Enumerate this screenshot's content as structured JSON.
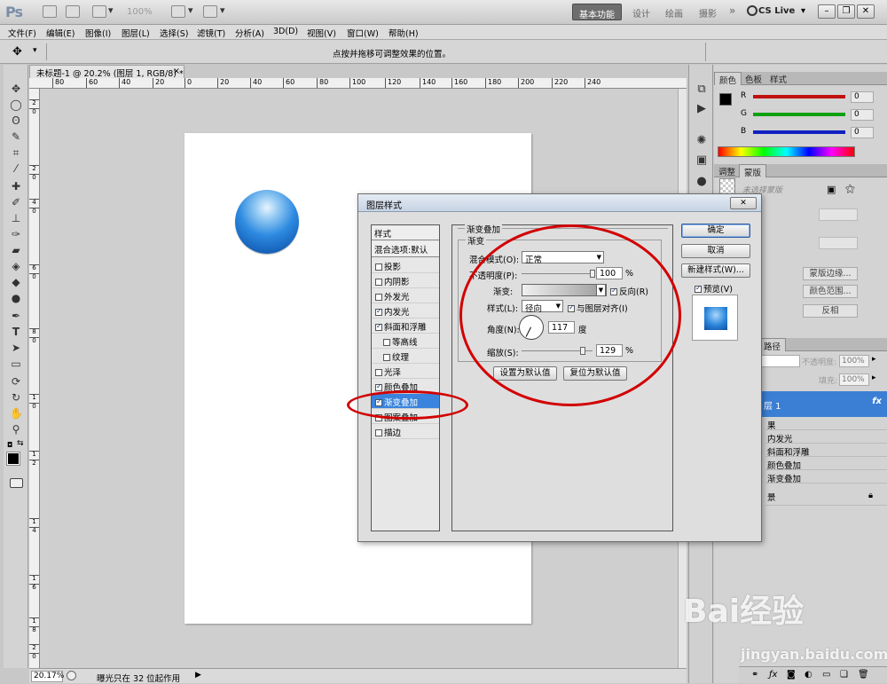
{
  "app": {
    "logo": "Ps"
  },
  "titlebar": {
    "zoom": "100%",
    "workspaces": [
      "基本功能",
      "设计",
      "绘画",
      "摄影"
    ],
    "more": "»",
    "cs_live": "CS Live",
    "cs_live_arrow": "▾"
  },
  "menu": [
    "文件(F)",
    "编辑(E)",
    "图像(I)",
    "图层(L)",
    "选择(S)",
    "滤镜(T)",
    "分析(A)",
    "3D(D)",
    "视图(V)",
    "窗口(W)",
    "帮助(H)"
  ],
  "options_bar": {
    "hint": "点按并拖移可调整效果的位置。"
  },
  "document": {
    "tab": "未标题-1 @ 20.2% (图层 1, RGB/8) *",
    "tab_close": "×"
  },
  "ruler": {
    "top": [
      "80",
      "60",
      "40",
      "20",
      "0",
      "20",
      "40",
      "60",
      "80",
      "100",
      "120",
      "140",
      "160",
      "180",
      "200",
      "220",
      "240"
    ],
    "left": [
      "2",
      "0",
      "2",
      "0",
      "4",
      "0",
      "6",
      "0",
      "8",
      "0",
      "1",
      "0",
      "1",
      "2",
      "1",
      "4",
      "1",
      "6",
      "1",
      "8",
      "2",
      "0"
    ]
  },
  "status": {
    "zoom": "20.17%",
    "text": "曝光只在 32 位起作用"
  },
  "panels": {
    "color_tabs": [
      "颜色",
      "色板",
      "样式"
    ],
    "color_channels": [
      {
        "label": "R",
        "value": "0",
        "color": "#c01010"
      },
      {
        "label": "G",
        "value": "0",
        "color": "#10a010"
      },
      {
        "label": "B",
        "value": "0",
        "color": "#1020c0"
      }
    ],
    "adjust_tabs": [
      "调整",
      "蒙版"
    ],
    "mask_label": "未选择蒙版",
    "mask_buttons": [
      "蒙版边缘...",
      "颜色范围...",
      "反相"
    ],
    "layers_tab": "路径",
    "opacity_label": "不透明度:",
    "opacity_value": "100%",
    "fill_label": "填充:",
    "fill_value": "100%",
    "layer_name": "层 1",
    "fx_badge": "fx",
    "effects_header": "果",
    "effects": [
      "内发光",
      "斜面和浮雕",
      "颜色叠加",
      "渐变叠加"
    ],
    "background_layer": "景"
  },
  "dialog": {
    "title": "图层样式",
    "close": "✕",
    "styles_header": "样式",
    "blend_options": "混合选项:默认",
    "styles": [
      {
        "label": "投影",
        "checked": false,
        "sub": false
      },
      {
        "label": "内阴影",
        "checked": false,
        "sub": false
      },
      {
        "label": "外发光",
        "checked": false,
        "sub": false
      },
      {
        "label": "内发光",
        "checked": true,
        "sub": false
      },
      {
        "label": "斜面和浮雕",
        "checked": true,
        "sub": false
      },
      {
        "label": "等高线",
        "checked": false,
        "sub": true
      },
      {
        "label": "纹理",
        "checked": false,
        "sub": true
      },
      {
        "label": "光泽",
        "checked": false,
        "sub": false
      },
      {
        "label": "颜色叠加",
        "checked": true,
        "sub": false
      },
      {
        "label": "渐变叠加",
        "checked": true,
        "sub": false,
        "selected": true
      },
      {
        "label": "图案叠加",
        "checked": false,
        "sub": false
      },
      {
        "label": "描边",
        "checked": false,
        "sub": false
      }
    ],
    "section_title": "渐变叠加",
    "group_title": "渐变",
    "blend_mode_label": "混合模式(O):",
    "blend_mode_value": "正常",
    "opacity_label": "不透明度(P):",
    "opacity_value": "100",
    "opacity_fraction": 1.0,
    "percent": "%",
    "gradient_label": "渐变:",
    "reverse_label": "反向(R)",
    "reverse_checked": true,
    "style_label": "样式(L):",
    "style_value": "径向",
    "align_label": "与图层对齐(I)",
    "align_checked": true,
    "angle_label": "角度(N):",
    "angle_value": "117",
    "angle_unit": "度",
    "scale_label": "缩放(S):",
    "scale_value": "129",
    "scale_fraction": 0.86,
    "set_default": "设置为默认值",
    "reset_default": "复位为默认值",
    "ok": "确定",
    "cancel": "取消",
    "new_style": "新建样式(W)...",
    "preview_label": "预览(V)",
    "preview_checked": true
  },
  "watermark": {
    "brand": "Bai经验",
    "url": "jingyan.baidu.com"
  }
}
